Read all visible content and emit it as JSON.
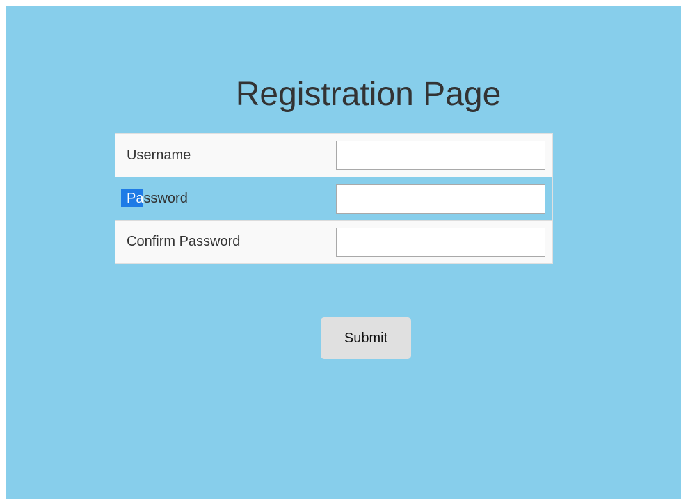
{
  "page": {
    "title": "Registration Page"
  },
  "form": {
    "rows": [
      {
        "label": "Username",
        "value": ""
      },
      {
        "label_selected": "Pa",
        "label_rest": "ssword",
        "value": ""
      },
      {
        "label": "Confirm Password",
        "value": ""
      }
    ],
    "submit_label": "Submit"
  },
  "colors": {
    "background": "#87ceeb",
    "row_background": "#f9f9f9",
    "selection": "#1e7be6",
    "button": "#e0e0e0"
  }
}
